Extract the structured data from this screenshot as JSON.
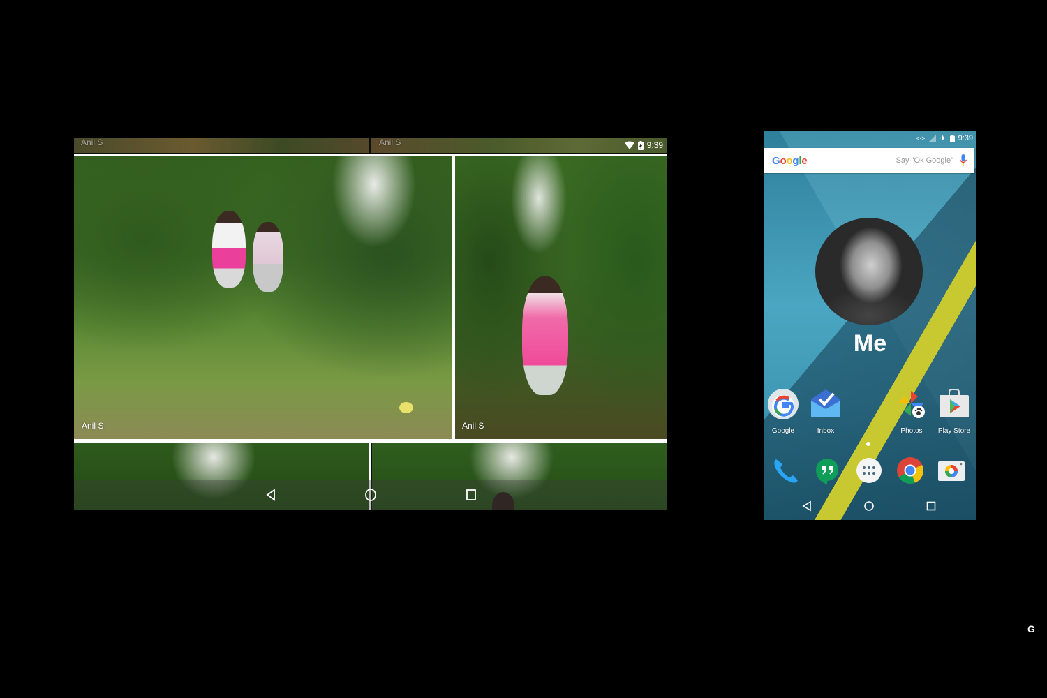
{
  "tablet": {
    "status": {
      "time": "9:39",
      "icons": [
        "wifi-icon",
        "battery-charging-icon"
      ]
    },
    "photos": [
      {
        "caption": "Anil S",
        "position": "top-left-partial"
      },
      {
        "caption": "Anil S",
        "position": "top-right-partial"
      },
      {
        "caption": "Anil S",
        "position": "large-left"
      },
      {
        "caption": "Anil S",
        "position": "large-right"
      },
      {
        "caption": "",
        "position": "bottom-left-partial"
      },
      {
        "caption": "",
        "position": "bottom-right-partial"
      }
    ],
    "nav": [
      "back",
      "home",
      "recents"
    ]
  },
  "phone": {
    "status": {
      "time": "9:39",
      "icons": [
        "data-sync-icon",
        "no-signal-icon",
        "airplane-icon",
        "battery-icon"
      ]
    },
    "search": {
      "logo": "Google",
      "hint": "Say \"Ok Google\""
    },
    "profile": {
      "name": "Me"
    },
    "apps": [
      {
        "label": "Google",
        "icon": "google-app-icon"
      },
      {
        "label": "Inbox",
        "icon": "inbox-icon"
      },
      {
        "label": "Photos",
        "icon": "photos-icon"
      },
      {
        "label": "Play Store",
        "icon": "play-store-icon"
      }
    ],
    "dock": [
      "phone-icon",
      "hangouts-icon",
      "app-drawer-icon",
      "chrome-icon",
      "camera-icon"
    ],
    "nav": [
      "back",
      "home",
      "recents"
    ]
  },
  "watermark": {
    "text": "G"
  },
  "colors": {
    "phone_bg": "#3f98b4",
    "accent_yellow": "#c8c830"
  }
}
